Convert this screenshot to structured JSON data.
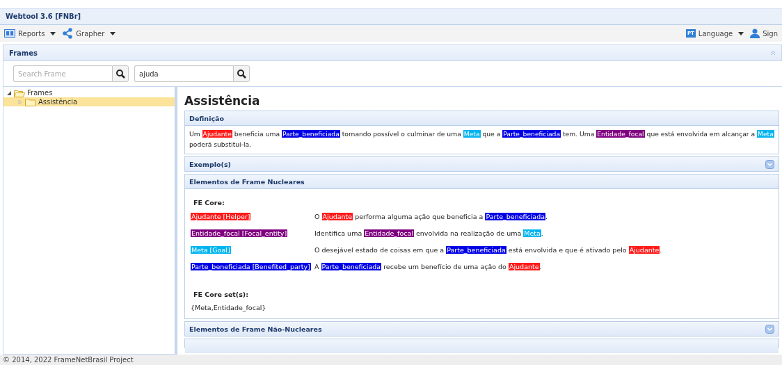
{
  "app": {
    "title": "Webtool 3.6 [FNBr]"
  },
  "menu": {
    "left": [
      {
        "label": "Reports",
        "kind": "reports"
      },
      {
        "label": "Grapher",
        "kind": "grapher"
      }
    ],
    "right": [
      {
        "label": "Language",
        "kind": "language",
        "badge": "PT"
      },
      {
        "label": "Sign",
        "kind": "user"
      }
    ]
  },
  "frames_panel": {
    "title": "Frames",
    "search_fields": [
      {
        "placeholder": "Search Frame"
      },
      {
        "value": "ajuda"
      }
    ]
  },
  "tree": [
    {
      "label": "Frames",
      "expanded": true,
      "children": [
        {
          "label": "Assistência",
          "selected": true,
          "expanded": false
        }
      ]
    }
  ],
  "content": {
    "title": "Assistência",
    "sections": [
      {
        "title": "Definição",
        "kind": "definition",
        "expanded": true,
        "segments": [
          {
            "text": "Um "
          },
          {
            "text": "Ajudante",
            "color": "#ff1a1a"
          },
          {
            "text": " beneficia uma "
          },
          {
            "text": "Parte_beneficiada",
            "color": "#0000e6"
          },
          {
            "text": " tornando possível o culminar de uma "
          },
          {
            "text": "Meta",
            "color": "#00b4f0"
          },
          {
            "text": " que a "
          },
          {
            "text": "Parte_beneficiada",
            "color": "#0000e6"
          },
          {
            "text": " tem. Uma "
          },
          {
            "text": "Entidade_focal",
            "color": "#800080"
          },
          {
            "text": " que está envolvida em alcançar a "
          },
          {
            "text": "Meta",
            "color": "#00b4f0"
          },
          {
            "text": " poderá substituí-la."
          }
        ]
      },
      {
        "title": "Exemplo(s)",
        "expanded": false
      },
      {
        "title": "Elementos de Frame Nucleares",
        "kind": "fe_core",
        "expanded": true,
        "heading": "FE Core:",
        "elements": [
          {
            "name": "Ajudante [Helper]",
            "color": "#ff1a1a",
            "definition": [
              {
                "text": "O "
              },
              {
                "text": "Ajudante",
                "color": "#ff1a1a"
              },
              {
                "text": " performa alguma ação que beneficia a "
              },
              {
                "text": "Parte_beneficiada",
                "color": "#0000e6"
              },
              {
                "text": "."
              }
            ]
          },
          {
            "name": "Entidade_focal [Focal_entity]",
            "color": "#800080",
            "definition": [
              {
                "text": "Identifica uma "
              },
              {
                "text": "Entidade_focal",
                "color": "#800080"
              },
              {
                "text": " envolvida na realização de uma "
              },
              {
                "text": "Meta",
                "color": "#00b4f0"
              },
              {
                "text": "."
              }
            ]
          },
          {
            "name": "Meta [Goal]",
            "color": "#00b4f0",
            "definition": [
              {
                "text": "O desejável estado de coisas em que a "
              },
              {
                "text": "Parte_beneficiada",
                "color": "#0000e6"
              },
              {
                "text": " está envolvida e que é ativado pelo "
              },
              {
                "text": "Ajudante",
                "color": "#ff1a1a"
              },
              {
                "text": "."
              }
            ]
          },
          {
            "name": "Parte_beneficiada [Benefited_party]",
            "color": "#0000e6",
            "definition": [
              {
                "text": "A "
              },
              {
                "text": "Parte_beneficiada",
                "color": "#0000e6"
              },
              {
                "text": " recebe um benefício de uma ação do "
              },
              {
                "text": "Ajudante",
                "color": "#ff1a1a"
              },
              {
                "text": "."
              }
            ]
          }
        ],
        "sets_heading": "FE Core set(s):",
        "sets": "{Meta,Entidade_focal}"
      },
      {
        "title": "Elementos de Frame Não-Nucleares",
        "expanded": false
      }
    ]
  },
  "footer": "© 2014, 2022 FrameNetBrasil Project"
}
